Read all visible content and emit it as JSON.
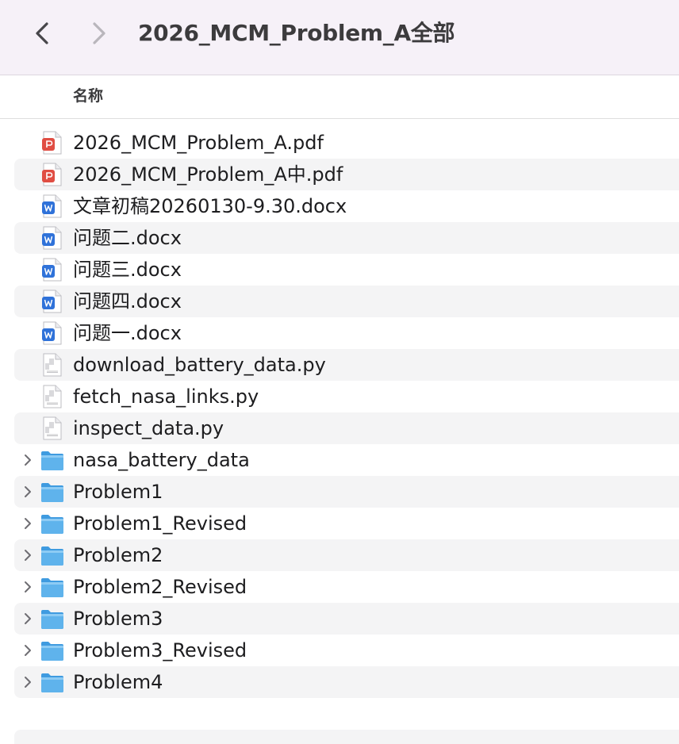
{
  "window": {
    "title": "2026_MCM_Problem_A全部"
  },
  "toolbar": {
    "back_icon": "chevron-left-icon",
    "forward_icon": "chevron-right-icon"
  },
  "columns": {
    "name": "名称"
  },
  "colors": {
    "toolbar_bg": "#f6f1f8",
    "stripe": "#f4f4f5",
    "folder_blue": "#5fb3ec",
    "pdf_red": "#e04d43",
    "word_blue": "#2f72d9"
  },
  "files": [
    {
      "name": "2026_MCM_Problem_A.pdf",
      "type": "pdf",
      "icon": "pdf-file-icon"
    },
    {
      "name": "2026_MCM_Problem_A中.pdf",
      "type": "pdf",
      "icon": "pdf-file-icon"
    },
    {
      "name": "文章初稿20260130-9.30.docx",
      "type": "docx",
      "icon": "word-file-icon"
    },
    {
      "name": "问题二.docx",
      "type": "docx",
      "icon": "word-file-icon"
    },
    {
      "name": "问题三.docx",
      "type": "docx",
      "icon": "word-file-icon"
    },
    {
      "name": "问题四.docx",
      "type": "docx",
      "icon": "word-file-icon"
    },
    {
      "name": "问题一.docx",
      "type": "docx",
      "icon": "word-file-icon"
    },
    {
      "name": "download_battery_data.py",
      "type": "py",
      "icon": "python-file-icon"
    },
    {
      "name": "fetch_nasa_links.py",
      "type": "py",
      "icon": "python-file-icon"
    },
    {
      "name": "inspect_data.py",
      "type": "py",
      "icon": "python-file-icon"
    },
    {
      "name": "nasa_battery_data",
      "type": "folder",
      "icon": "folder-icon"
    },
    {
      "name": "Problem1",
      "type": "folder",
      "icon": "folder-icon"
    },
    {
      "name": "Problem1_Revised",
      "type": "folder",
      "icon": "folder-icon"
    },
    {
      "name": "Problem2",
      "type": "folder",
      "icon": "folder-icon"
    },
    {
      "name": "Problem2_Revised",
      "type": "folder",
      "icon": "folder-icon"
    },
    {
      "name": "Problem3",
      "type": "folder",
      "icon": "folder-icon"
    },
    {
      "name": "Problem3_Revised",
      "type": "folder",
      "icon": "folder-icon"
    },
    {
      "name": "Problem4",
      "type": "folder",
      "icon": "folder-icon"
    }
  ]
}
